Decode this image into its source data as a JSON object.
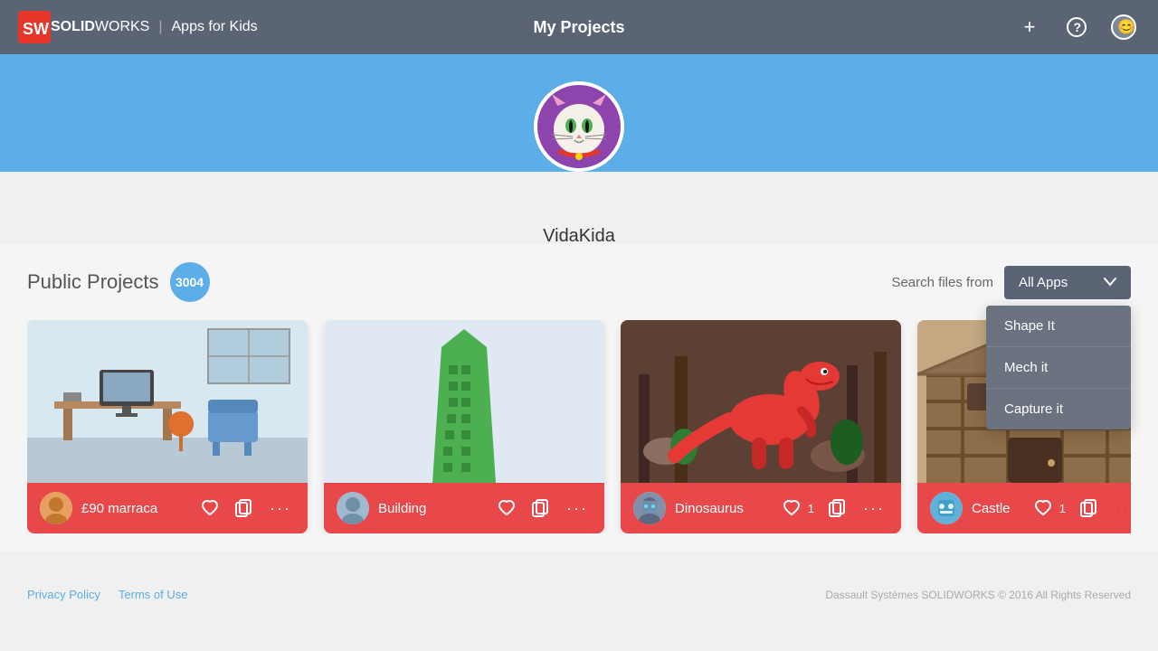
{
  "header": {
    "logo_brand": "SOLID",
    "logo_brand2": "WORKS",
    "logo_separator": "|",
    "logo_apps": "Apps for Kids",
    "title": "My Projects",
    "add_label": "+",
    "help_label": "?",
    "user_icon": "😊"
  },
  "banner": {
    "avatar_emoji": "🐱",
    "username": "VidaKida"
  },
  "projects_section": {
    "title": "Public Projects",
    "count": "3004",
    "search_label": "Search files from",
    "dropdown_label": "All Apps",
    "dropdown_items": [
      {
        "label": "Shape It"
      },
      {
        "label": "Mech it"
      },
      {
        "label": "Capture it"
      }
    ]
  },
  "cards": [
    {
      "id": "card-1",
      "name": "£90 marraca",
      "likes": "",
      "avatar_emoji": "👤",
      "bg_color": "#c5d8e8",
      "scene_emoji": "🪑"
    },
    {
      "id": "card-2",
      "name": "Building",
      "likes": "",
      "avatar_emoji": "👤",
      "bg_color": "#dce8f0",
      "scene_emoji": "🏢"
    },
    {
      "id": "card-3",
      "name": "Dinosaurus",
      "likes": "1",
      "avatar_emoji": "👤",
      "bg_color": "#7b5e4a",
      "scene_emoji": "🦕"
    },
    {
      "id": "card-4",
      "name": "Castle",
      "likes": "1",
      "avatar_emoji": "👤",
      "bg_color": "#c4a882",
      "scene_emoji": "🏰"
    }
  ],
  "footer": {
    "privacy_policy": "Privacy Policy",
    "terms_of_use": "Terms of Use",
    "copyright": "Dassault Systèmes SOLIDWORKS © 2016 All Rights Reserved"
  }
}
